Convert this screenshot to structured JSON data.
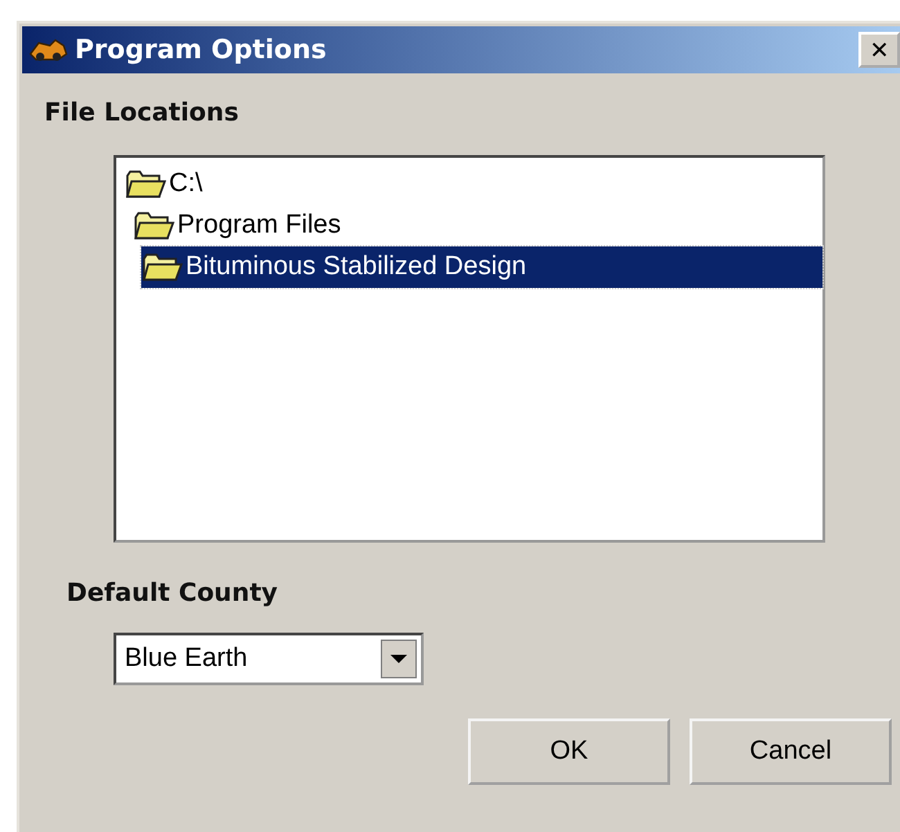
{
  "window": {
    "title": "Program Options",
    "close": "✕"
  },
  "file_locations": {
    "label": "File Locations",
    "tree": [
      {
        "label": "C:\\",
        "selected": false,
        "children": [
          {
            "label": "Program Files",
            "selected": false,
            "children": [
              {
                "label": "Bituminous Stabilized Design",
                "selected": true
              }
            ]
          }
        ]
      }
    ]
  },
  "default_county": {
    "label": "Default County",
    "value": "Blue Earth"
  },
  "buttons": [
    "OK",
    "Cancel"
  ]
}
